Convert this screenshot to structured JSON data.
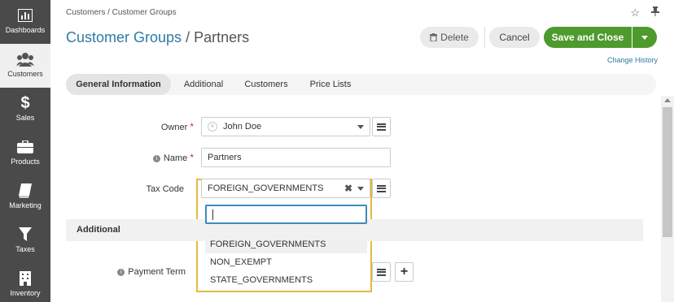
{
  "sidebar": {
    "items": [
      {
        "label": "Dashboards",
        "icon": "dashboard-icon"
      },
      {
        "label": "Customers",
        "icon": "customers-icon",
        "active": true
      },
      {
        "label": "Sales",
        "icon": "dollar-icon"
      },
      {
        "label": "Products",
        "icon": "briefcase-icon"
      },
      {
        "label": "Marketing",
        "icon": "book-icon"
      },
      {
        "label": "Taxes",
        "icon": "filter-icon"
      },
      {
        "label": "Inventory",
        "icon": "building-icon"
      }
    ]
  },
  "header": {
    "breadcrumb": "Customers / Customer Groups",
    "title_link": "Customer Groups",
    "title_sep": " / ",
    "title_current": "Partners",
    "delete_label": "Delete",
    "cancel_label": "Cancel",
    "save_label": "Save and Close",
    "change_history": "Change History"
  },
  "tabs": [
    {
      "label": "General Information",
      "active": true
    },
    {
      "label": "Additional"
    },
    {
      "label": "Customers"
    },
    {
      "label": "Price Lists"
    }
  ],
  "form": {
    "owner_label": "Owner",
    "owner_value": "John Doe",
    "name_label": "Name",
    "name_value": "Partners",
    "tax_code_label": "Tax Code",
    "tax_code_value": "FOREIGN_GOVERNMENTS",
    "additional_section": "Additional",
    "payment_term_label": "Payment Term",
    "required_mark": "*"
  },
  "dropdown": {
    "search_value": "",
    "options": [
      "FOREIGN_GOVERNMENTS",
      "NON_EXEMPT",
      "STATE_GOVERNMENTS"
    ]
  },
  "colors": {
    "sidebar_bg": "#4a4a4a",
    "accent_link": "#2f7aa5",
    "save_button": "#4e9a2d",
    "dropdown_border": "#e5b93f",
    "search_focus": "#3b8bbf"
  }
}
